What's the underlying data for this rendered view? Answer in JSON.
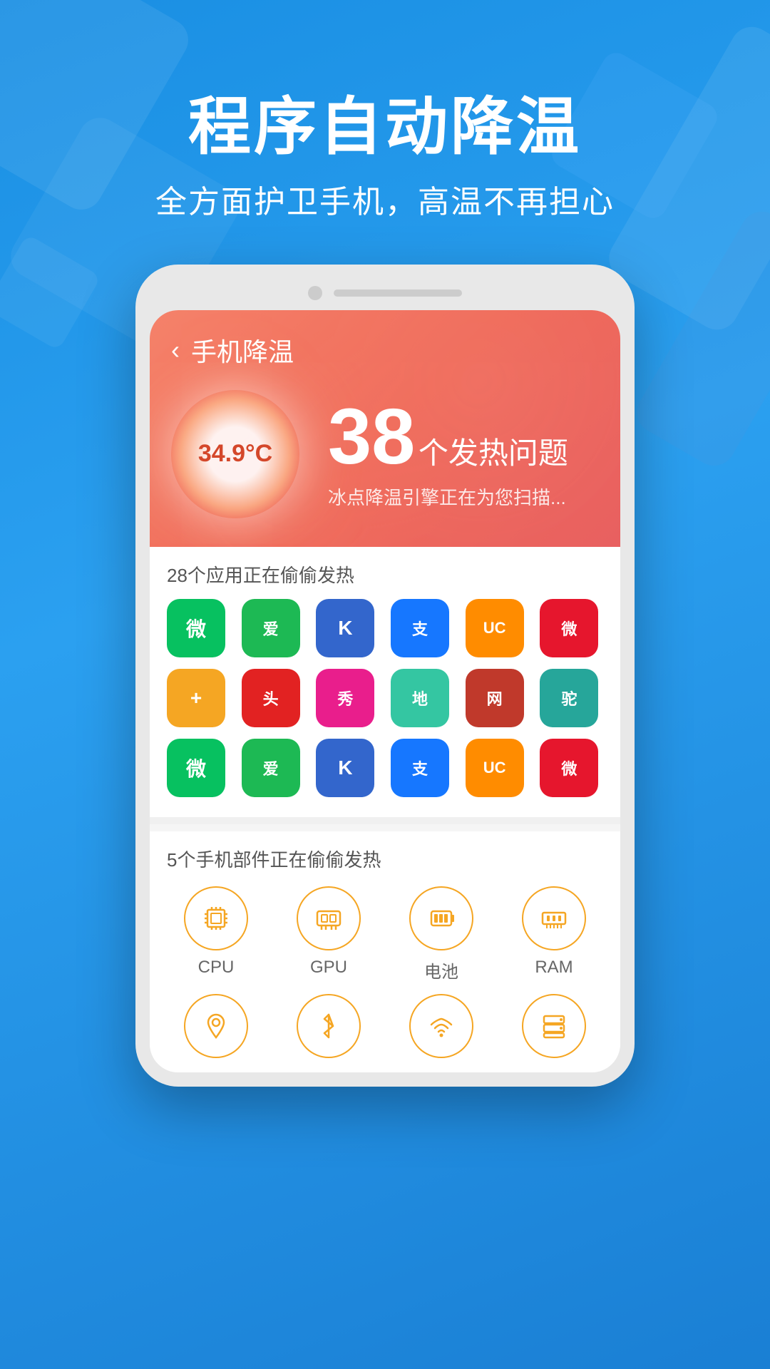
{
  "background": {
    "gradient_start": "#1a8fe3",
    "gradient_end": "#1a7fd4"
  },
  "header": {
    "title": "程序自动降温",
    "subtitle": "全方面护卫手机，高温不再担心"
  },
  "app_screen": {
    "nav": {
      "back_label": "‹",
      "title": "手机降温"
    },
    "temperature": {
      "value": "34.9°C"
    },
    "issues": {
      "count": "38",
      "label": "个发热问题",
      "description": "冰点降温引擎正在为您扫描..."
    },
    "apps_section": {
      "title": "28个应用正在偷偷发热",
      "apps": [
        {
          "name": "WeChat",
          "color": "#07C160",
          "text": "微"
        },
        {
          "name": "iQIYI",
          "color": "#00B050",
          "text": "爱"
        },
        {
          "name": "Kuwo",
          "color": "#3366CC",
          "text": "K"
        },
        {
          "name": "Alipay",
          "color": "#1677FF",
          "text": "支"
        },
        {
          "name": "UC",
          "color": "#FF6600",
          "text": "UC"
        },
        {
          "name": "Weibo",
          "color": "#E6162D",
          "text": "微"
        },
        {
          "name": "Doctor",
          "color": "#F5A623",
          "text": "+"
        },
        {
          "name": "Toutiao",
          "color": "#E22222",
          "text": "头"
        },
        {
          "name": "Xiu",
          "color": "#E91E8C",
          "text": "秀"
        },
        {
          "name": "Maps",
          "color": "#34C6A2",
          "text": "地"
        },
        {
          "name": "NetEase",
          "color": "#C0392B",
          "text": "网"
        },
        {
          "name": "Camel",
          "color": "#26A69A",
          "text": "驼"
        },
        {
          "name": "WeChat2",
          "color": "#07C160",
          "text": "微"
        },
        {
          "name": "iQIYI2",
          "color": "#00B050",
          "text": "爱"
        },
        {
          "name": "Kuwo2",
          "color": "#3366CC",
          "text": "K"
        },
        {
          "name": "Alipay2",
          "color": "#1677FF",
          "text": "支"
        },
        {
          "name": "UC2",
          "color": "#FF6600",
          "text": "UC"
        },
        {
          "name": "Weibo2",
          "color": "#E6162D",
          "text": "微"
        }
      ]
    },
    "components_section": {
      "title": "5个手机部件正在偷偷发热",
      "components_row1": [
        {
          "id": "cpu",
          "label": "CPU",
          "icon": "cpu"
        },
        {
          "id": "gpu",
          "label": "GPU",
          "icon": "gpu"
        },
        {
          "id": "battery",
          "label": "电池",
          "icon": "battery"
        },
        {
          "id": "ram",
          "label": "RAM",
          "icon": "ram"
        }
      ],
      "components_row2": [
        {
          "id": "location",
          "label": "",
          "icon": "location"
        },
        {
          "id": "bluetooth",
          "label": "",
          "icon": "bluetooth"
        },
        {
          "id": "wifi",
          "label": "",
          "icon": "wifi"
        },
        {
          "id": "storage",
          "label": "",
          "icon": "storage"
        }
      ]
    }
  }
}
